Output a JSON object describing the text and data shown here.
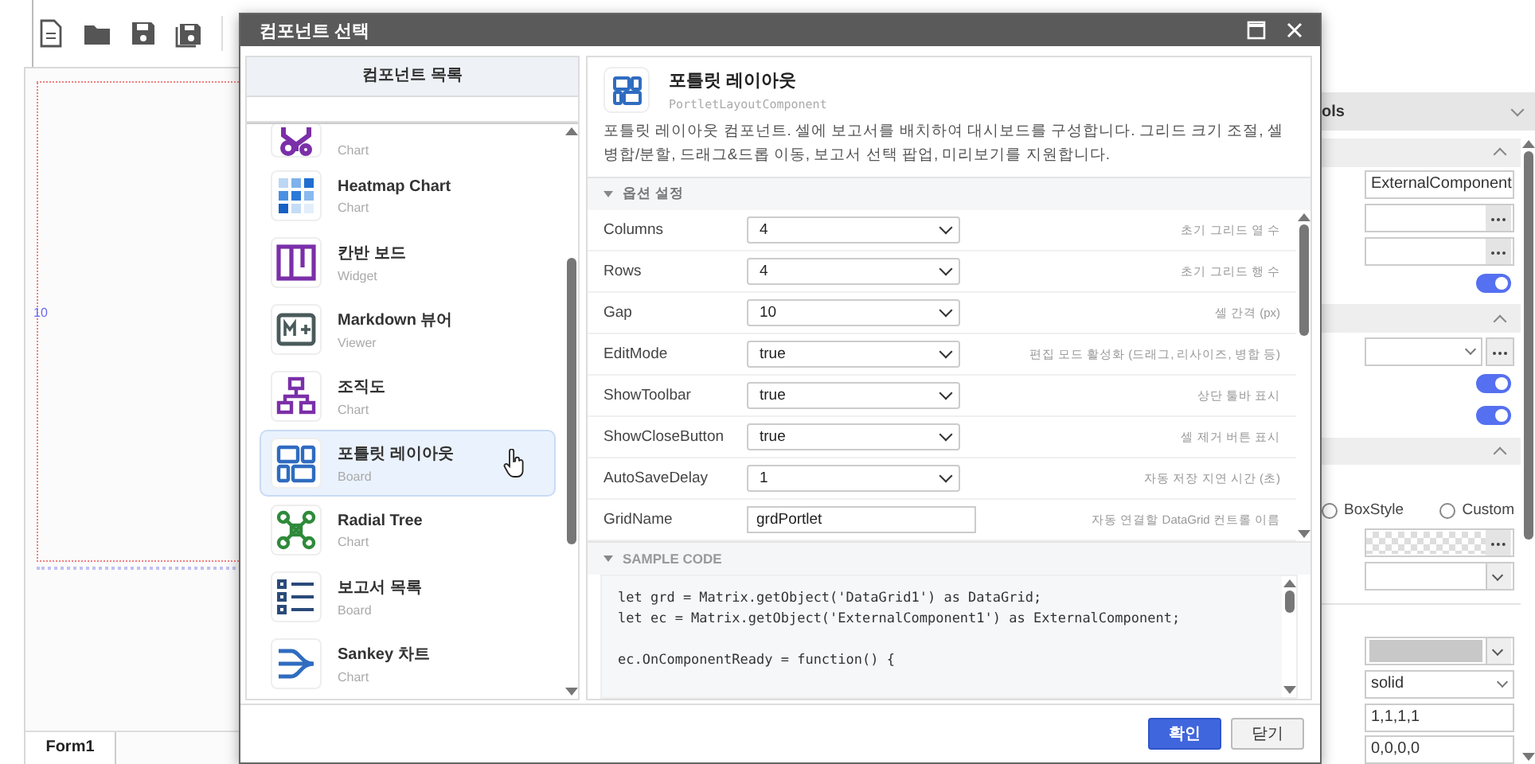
{
  "canvas": {
    "ruler_label": "10"
  },
  "form_tabs": [
    {
      "label": "Form1",
      "selected": true
    }
  ],
  "properties": {
    "header": "ols",
    "sections": [
      {
        "expanded": true,
        "rows": [
          {
            "kind": "text",
            "value": "ExternalComponent"
          },
          {
            "kind": "picker"
          },
          {
            "kind": "picker"
          },
          {
            "kind": "toggle",
            "on": true
          }
        ]
      },
      {
        "expanded": true,
        "rows": [
          {
            "kind": "select-picker"
          },
          {
            "kind": "toggle",
            "on": true
          },
          {
            "kind": "toggle",
            "on": true
          }
        ]
      },
      {
        "expanded": true,
        "rows": [
          {
            "kind": "blank"
          },
          {
            "kind": "radios",
            "options": [
              {
                "label": "BoxStyle",
                "selected": false
              },
              {
                "label": "Custom",
                "selected": false
              }
            ]
          },
          {
            "kind": "pattern-picker"
          },
          {
            "kind": "select"
          }
        ]
      },
      {
        "rows": [
          {
            "kind": "blank"
          },
          {
            "kind": "swatch-select"
          },
          {
            "kind": "select",
            "value": "solid"
          },
          {
            "kind": "text",
            "value": "1,1,1,1"
          },
          {
            "kind": "text",
            "value": "0,0,0,0"
          }
        ]
      }
    ]
  },
  "dialog": {
    "title": "컴포넌트 선택",
    "list": {
      "header": "컴포넌트 목록",
      "items": [
        {
          "category": "Chart",
          "selected": false
        },
        {
          "title": "Heatmap Chart",
          "category": "Chart",
          "selected": false
        },
        {
          "title": "칸반 보드",
          "category": "Widget",
          "selected": false
        },
        {
          "title": "Markdown 뷰어",
          "category": "Viewer",
          "selected": false
        },
        {
          "title": "조직도",
          "category": "Chart",
          "selected": false
        },
        {
          "title": "포틀릿 레이아웃",
          "category": "Board",
          "selected": true
        },
        {
          "title": "Radial Tree",
          "category": "Chart",
          "selected": false
        },
        {
          "title": "보고서 목록",
          "category": "Board",
          "selected": false
        },
        {
          "title": "Sankey 차트",
          "category": "Chart",
          "selected": false
        }
      ]
    },
    "detail": {
      "title": "포틀릿 레이아웃",
      "class_name": "PortletLayoutComponent",
      "description": "포틀릿 레이아웃 컴포넌트. 셀에 보고서를 배치하여 대시보드를 구성합니다. 그리드 크기 조절, 셀 병합/분할, 드래그&드롭 이동, 보고서 선택 팝업, 미리보기를 지원합니다.",
      "options_header": "옵션 설정",
      "options_expanded": true,
      "options": [
        {
          "name": "Columns",
          "kind": "select",
          "value": "4",
          "hint": "초기 그리드 열 수"
        },
        {
          "name": "Rows",
          "kind": "select",
          "value": "4",
          "hint": "초기 그리드 행 수"
        },
        {
          "name": "Gap",
          "kind": "select",
          "value": "10",
          "hint": "셀 간격 (px)"
        },
        {
          "name": "EditMode",
          "kind": "select",
          "value": "true",
          "hint": "편집 모드 활성화 (드래그, 리사이즈, 병합 등)"
        },
        {
          "name": "ShowToolbar",
          "kind": "select",
          "value": "true",
          "hint": "상단 툴바 표시"
        },
        {
          "name": "ShowCloseButton",
          "kind": "select",
          "value": "true",
          "hint": "셀 제거 버튼 표시"
        },
        {
          "name": "AutoSaveDelay",
          "kind": "select",
          "value": "1",
          "hint": "자동 저장 지연 시간 (초)"
        },
        {
          "name": "GridName",
          "kind": "input",
          "value": "grdPortlet",
          "hint": "자동 연결할 DataGrid 컨트롤 이름"
        }
      ],
      "code_header": "SAMPLE CODE",
      "code_expanded": true,
      "code": "let grd = Matrix.getObject('DataGrid1') as DataGrid;\nlet ec = Matrix.getObject('ExternalComponent1') as ExternalComponent;\n\nec.OnComponentReady = function() {"
    },
    "buttons": [
      {
        "label": "확인",
        "kind": "primary"
      },
      {
        "label": "닫기",
        "kind": "secondary"
      }
    ]
  }
}
